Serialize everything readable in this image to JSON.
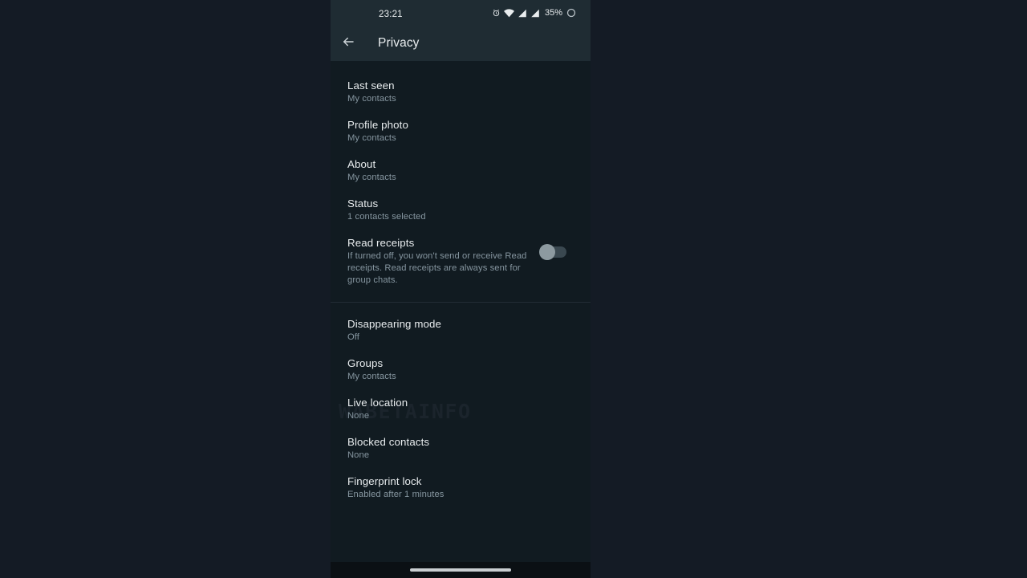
{
  "statusbar": {
    "time": "23:21",
    "battery_text": "35%",
    "icons": [
      "alarm-icon",
      "wifi-icon",
      "signal-icon-1",
      "signal-icon-2",
      "battery-icon"
    ]
  },
  "appbar": {
    "back_label": "back-arrow",
    "title": "Privacy"
  },
  "watermark": {
    "text": "WABETAINFO"
  },
  "settings": {
    "group_one": [
      {
        "title": "Last seen",
        "subtitle": "My contacts"
      },
      {
        "title": "Profile photo",
        "subtitle": "My contacts"
      },
      {
        "title": "About",
        "subtitle": "My contacts"
      },
      {
        "title": "Status",
        "subtitle": "1 contacts selected"
      }
    ],
    "read_receipts": {
      "title": "Read receipts",
      "subtitle": "If turned off, you won't send or receive Read receipts. Read receipts are always sent for group chats.",
      "toggle_state": "off"
    },
    "group_two": [
      {
        "title": "Disappearing mode",
        "subtitle": "Off"
      },
      {
        "title": "Groups",
        "subtitle": "My contacts"
      },
      {
        "title": "Live location",
        "subtitle": "None"
      },
      {
        "title": "Blocked contacts",
        "subtitle": "None"
      },
      {
        "title": "Fingerprint lock",
        "subtitle": "Enabled after 1 minutes"
      }
    ]
  },
  "colors": {
    "appbar_bg": "#1f2c33",
    "content_bg": "#111b21",
    "page_bg": "#141b25",
    "primary_text": "#e9edef",
    "secondary_text": "#8696a0",
    "toggle_knob": "#8d9aa0"
  }
}
